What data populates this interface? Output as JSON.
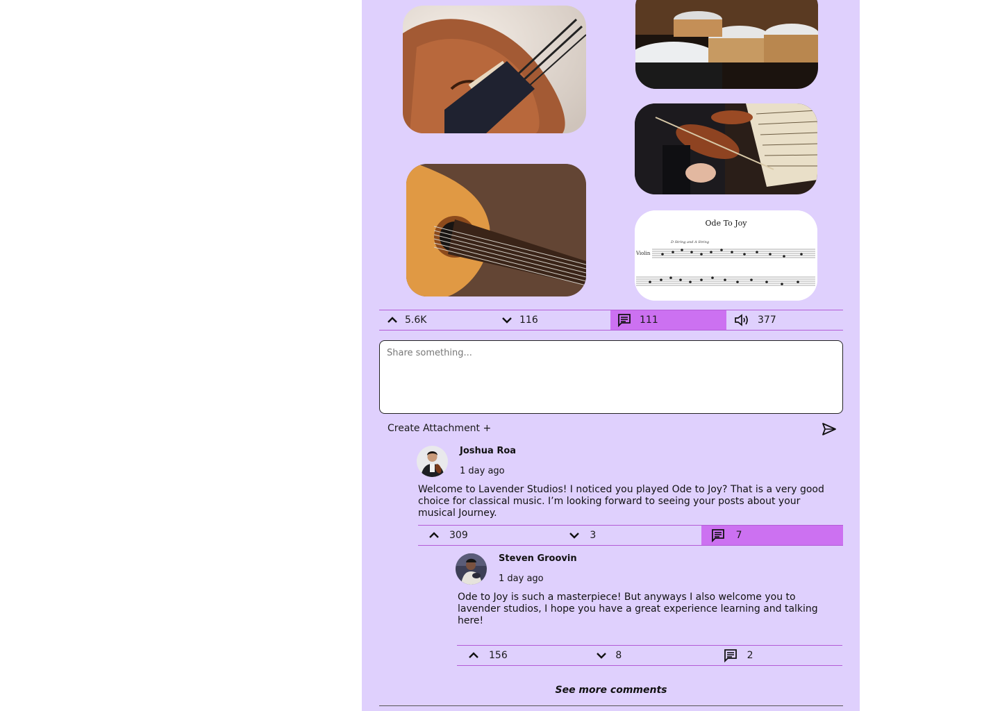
{
  "post": {
    "images": [
      {
        "name": "violin",
        "alt": "violin-photo"
      },
      {
        "name": "drums",
        "alt": "drum-kit-photo"
      },
      {
        "name": "orchestra",
        "alt": "orchestra-photo"
      },
      {
        "name": "guitar",
        "alt": "guitar-photo"
      },
      {
        "name": "sheet-music",
        "alt": "sheet-music-photo"
      }
    ],
    "sheet_title": "Ode To Joy",
    "sheet_instrument": "Violin",
    "sheet_note": "D String and A String",
    "stats": {
      "upvotes": "5.6K",
      "downvotes": "116",
      "comments": "111",
      "listens": "377"
    }
  },
  "composer": {
    "placeholder": "Share something...",
    "attachment_label": "Create Attachment +"
  },
  "comments": [
    {
      "author": "Joshua Roa",
      "time": "1 day ago",
      "text": "Welcome to Lavender Studios! I noticed you played Ode to Joy? That is a very good choice for classical music. I’m looking forward to seeing your posts about your musical Journey.",
      "upvotes": "309",
      "downvotes": "3",
      "replies": "7"
    },
    {
      "author": "Steven Groovin",
      "time": "1 day ago",
      "text": "Ode to Joy is such a masterpiece! But anyways I also welcome you to lavender studios, I hope you have a great experience learning and talking here!",
      "upvotes": "156",
      "downvotes": "8",
      "replies": "2"
    }
  ],
  "see_more_label": "See more comments",
  "colors": {
    "panel": "#dfd0fd",
    "active_stat": "#cc71f1",
    "divider": "#b35bd6"
  }
}
